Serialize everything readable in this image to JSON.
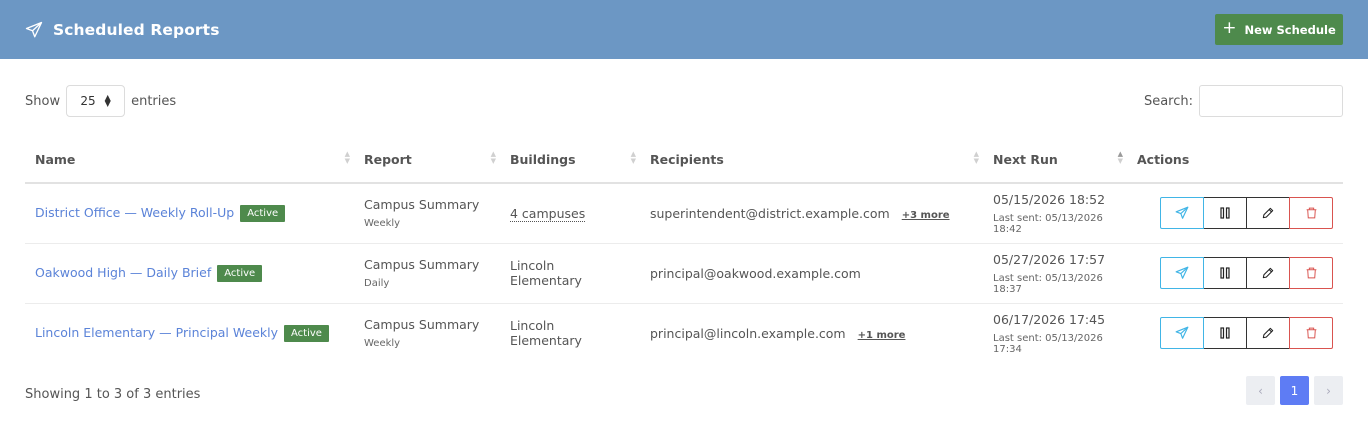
{
  "header": {
    "title": "Scheduled Reports",
    "new_button": "New Schedule"
  },
  "length_control": {
    "prefix": "Show",
    "value": "25",
    "suffix": "entries"
  },
  "search": {
    "label": "Search:",
    "value": ""
  },
  "columns": [
    "Name",
    "Report",
    "Buildings",
    "Recipients",
    "Next Run",
    "Actions"
  ],
  "rows": [
    {
      "name": "District Office — Weekly Roll-Up",
      "status": "Active",
      "report": "Campus Summary",
      "frequency": "Weekly",
      "buildings": "4 campuses",
      "recipient": "superintendent@district.example.com",
      "more": "+3 more",
      "next_run": "05/15/2026 18:52",
      "last_sent": "Last sent: 05/13/2026 18:42"
    },
    {
      "name": "Oakwood High — Daily Brief",
      "status": "Active",
      "report": "Campus Summary",
      "frequency": "Daily",
      "buildings": "Lincoln Elementary",
      "recipient": "principal@oakwood.example.com",
      "more": "",
      "next_run": "05/27/2026 17:57",
      "last_sent": "Last sent: 05/13/2026 18:37"
    },
    {
      "name": "Lincoln Elementary — Principal Weekly",
      "status": "Active",
      "report": "Campus Summary",
      "frequency": "Weekly",
      "buildings": "Lincoln Elementary",
      "recipient": "principal@lincoln.example.com",
      "more": "+1 more",
      "next_run": "06/17/2026 17:45",
      "last_sent": "Last sent: 05/13/2026 17:34"
    }
  ],
  "footer": {
    "info": "Showing 1 to 3 of 3 entries",
    "prev": "‹",
    "page": "1",
    "next": "›"
  },
  "icons": {
    "header": "paper-plane-icon",
    "send": "paper-plane-icon",
    "pause": "pause-icon",
    "edit": "pencil-icon",
    "delete": "trash-icon"
  },
  "colors": {
    "header_bg": "#6c97c4",
    "primary_green": "#4e8a4c",
    "link": "#5b83d8",
    "send": "#41b5e6",
    "delete": "#d9534f",
    "page_active": "#5e7cf4"
  }
}
